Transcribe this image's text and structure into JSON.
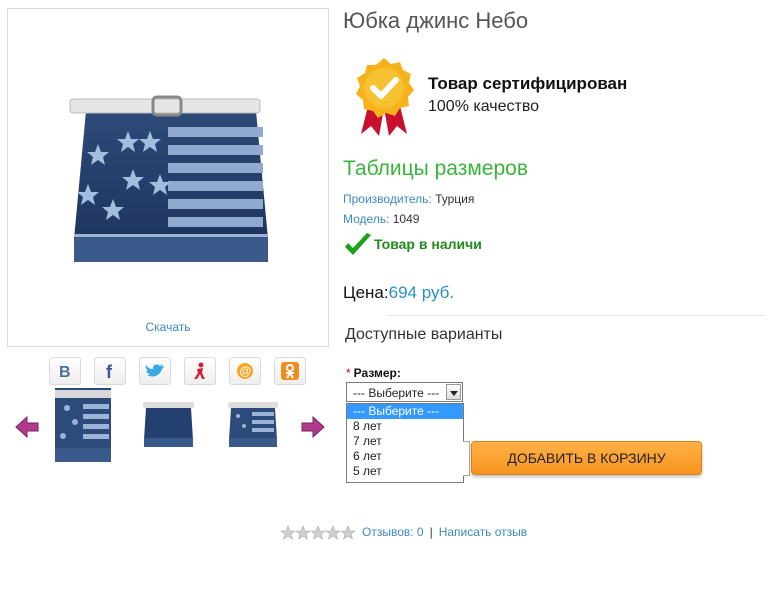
{
  "product": {
    "title": "Юбка джинс Небо",
    "download_label": "Скачать"
  },
  "certification": {
    "title": "Товар сертифицирован",
    "subtitle": "100% качество"
  },
  "size_tables_label": "Таблицы размеров",
  "specs": {
    "manufacturer_label": "Производитель:",
    "manufacturer_value": "Турция",
    "model_label": "Модель:",
    "model_value": "1049"
  },
  "stock": {
    "label": "Товар в наличи"
  },
  "price": {
    "label": "Цена:",
    "value": "694 руб."
  },
  "variants": {
    "heading": "Доступные варианты",
    "size_label": "Размер:",
    "required_mark": "*",
    "select_value": "--- Выберите ---",
    "options": [
      "--- Выберите ---",
      "8 лет",
      "7 лет",
      "6 лет",
      "5 лет"
    ]
  },
  "cart": {
    "button_label": "ДОБАВИТЬ В КОРЗИНУ"
  },
  "social": [
    "vk-icon",
    "facebook-icon",
    "twitter-icon",
    "odnoklassniki-person-icon",
    "mail-ru-icon",
    "ok-icon"
  ],
  "reviews": {
    "rating_stars": 0,
    "count_label": "Отзывов: 0",
    "separator": "|",
    "write_label": "Написать отзыв"
  },
  "colors": {
    "link": "#3a8ac4",
    "green": "#3ab53a",
    "price": "#2a90c9",
    "cart_button": "#f7931e",
    "arrow": "#b03a8c"
  }
}
